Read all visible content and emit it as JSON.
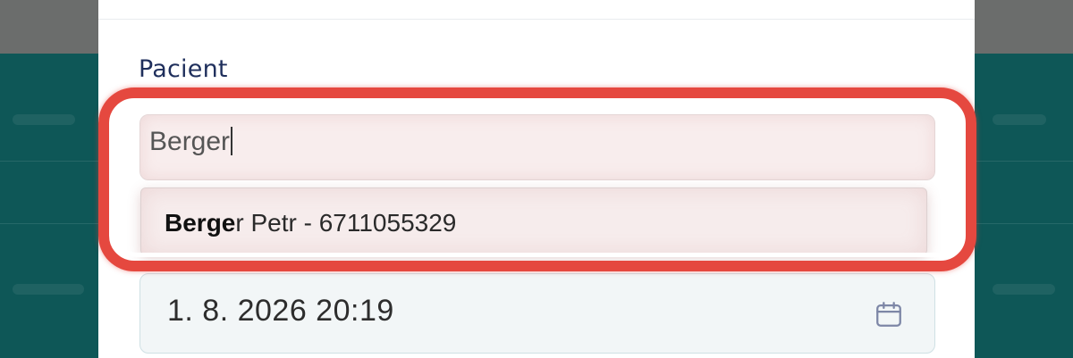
{
  "patient_field": {
    "label": "Pacient",
    "search_value": "Berger",
    "suggestions": [
      {
        "match": "Berge",
        "rest": "r Petr - 6711055329"
      }
    ]
  },
  "date_field": {
    "value": "1. 8. 2026 20:19",
    "icon": "calendar-icon"
  },
  "colors": {
    "label": "#1f2f5c",
    "highlight": "#e5483f",
    "backdrop_teal": "#0e5757"
  }
}
